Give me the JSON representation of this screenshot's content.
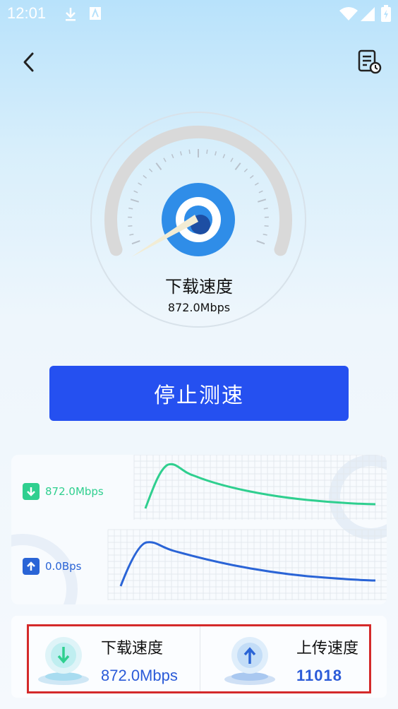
{
  "status_bar": {
    "time": "12:01"
  },
  "gauge": {
    "label": "下载速度",
    "value": "872.0Mbps"
  },
  "stop_button": {
    "label": "停止测速"
  },
  "chart": {
    "download_label": "872.0Mbps",
    "upload_label": "0.0Bps",
    "download_color": "#2fcf8f",
    "upload_color": "#2a64d6"
  },
  "stats": {
    "download": {
      "title": "下载速度",
      "value": "872.0Mbps"
    },
    "upload": {
      "title": "上传速度",
      "value": "11018"
    }
  },
  "colors": {
    "accent": "#2550f0",
    "highlight": "#d42a2a"
  }
}
